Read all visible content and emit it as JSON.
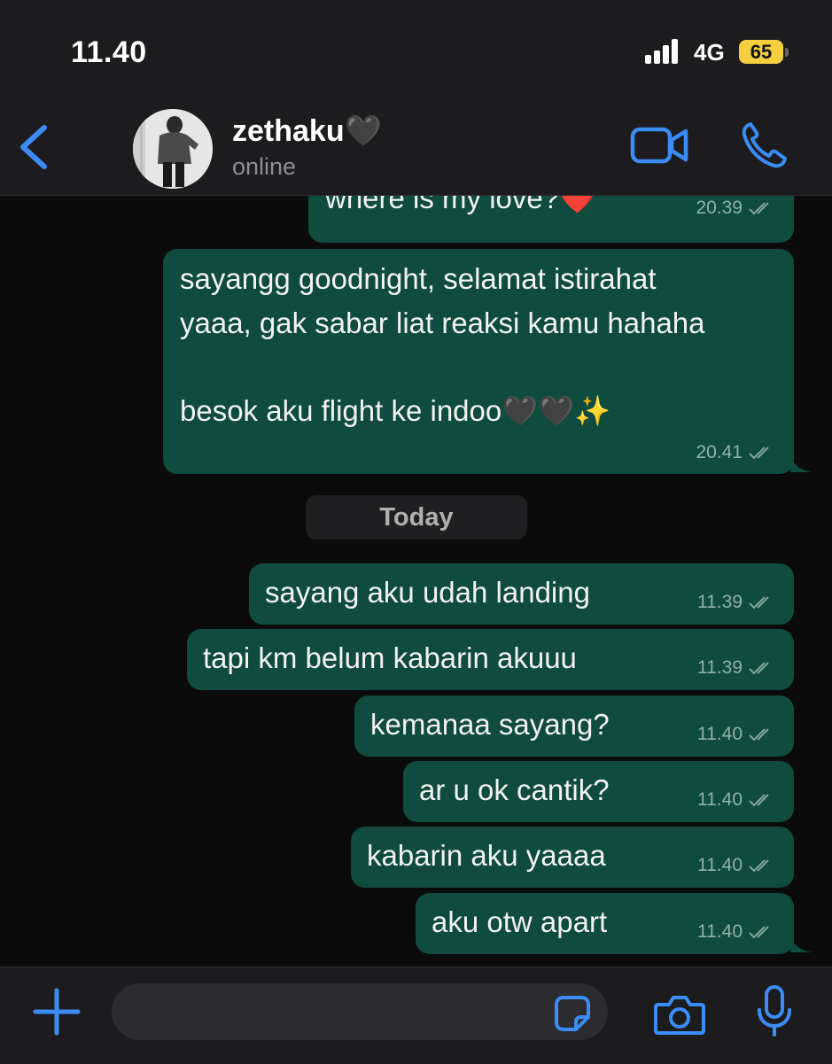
{
  "status_bar": {
    "time": "11.40",
    "network": "4G",
    "battery": "65",
    "icons": [
      "signal-icon",
      "battery-icon"
    ]
  },
  "header": {
    "back_icon": "chevron-left-icon",
    "contact_name": "zethaku🖤",
    "contact_status": "online",
    "actions": [
      "video-call-icon",
      "phone-icon"
    ]
  },
  "date_separator": "Today",
  "messages": [
    {
      "text": "where is my love?❤️",
      "time": "20.39"
    },
    {
      "lines": [
        "sayangg goodnight, selamat istirahat",
        "yaaa, gak sabar liat reaksi kamu hahaha",
        "",
        "besok aku flight ke indoo🖤🖤✨"
      ],
      "time": "20.41"
    },
    {
      "text": "sayang aku udah landing",
      "time": "11.39"
    },
    {
      "text": "tapi km belum kabarin akuuu",
      "time": "11.39"
    },
    {
      "text": "kemanaa sayang?",
      "time": "11.40"
    },
    {
      "text": "ar u ok cantik?",
      "time": "11.40"
    },
    {
      "text": "kabarin aku yaaaa",
      "time": "11.40"
    },
    {
      "text": "aku otw apart",
      "time": "11.40"
    }
  ],
  "input_bar": {
    "placeholder": "",
    "icons": [
      "plus-icon",
      "sticker-icon",
      "camera-icon",
      "microphone-icon"
    ]
  },
  "colors": {
    "accent": "#3b8cf5",
    "bubble_outgoing": "#0f4b3e",
    "background": "#0b0b0b",
    "bar": "#1c1c1e"
  }
}
